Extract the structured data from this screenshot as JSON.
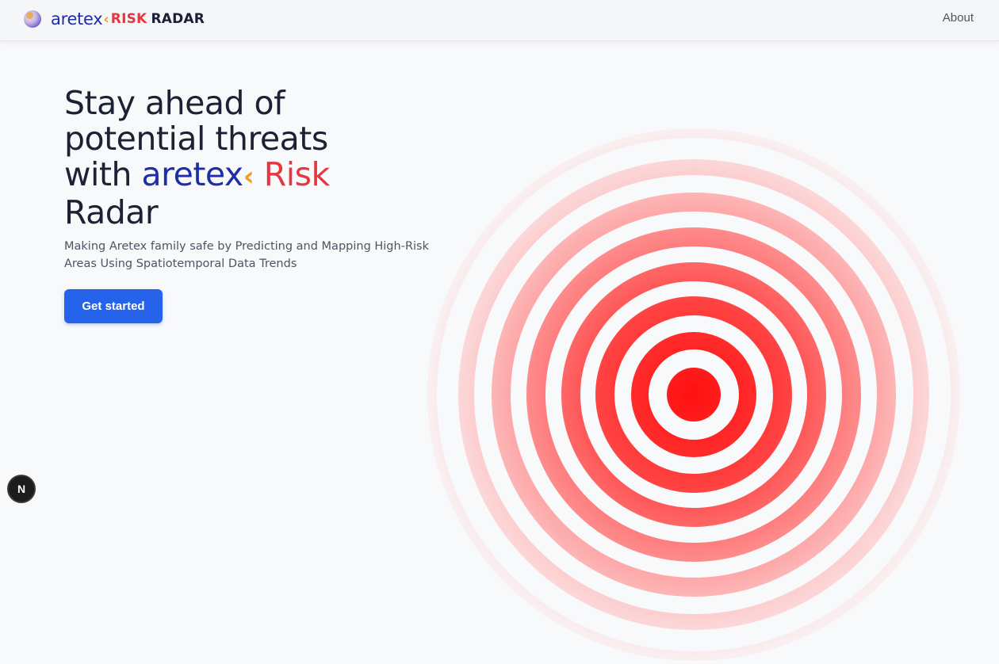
{
  "navbar": {
    "logo_icon": "aretex-globe-logo",
    "brand_aretex": "aretex",
    "brand_chevron": "‹",
    "brand_risk": "RISK",
    "brand_radar": "RADAR",
    "about_label": "About"
  },
  "hero": {
    "title_line1": "Stay ahead of",
    "title_line2": "potential threats",
    "title_with": "with",
    "title_aretex": "aretex",
    "title_chevron": "‹",
    "title_risk": "Risk",
    "title_radar": "Radar",
    "subtitle": "Making Aretex family safe by Predicting and Mapping High-Risk Areas Using Spatiotemporal Data Trends",
    "cta_label": "Get started"
  },
  "radar": {
    "icon": "radar-rings-graphic",
    "color": "#ff1a1a"
  },
  "dev_badge": {
    "icon": "nextjs-icon",
    "label": "N"
  },
  "colors": {
    "brand_blue": "#1f2ea6",
    "brand_orange": "#f59a23",
    "brand_red": "#e53740",
    "cta_blue": "#2563eb"
  }
}
